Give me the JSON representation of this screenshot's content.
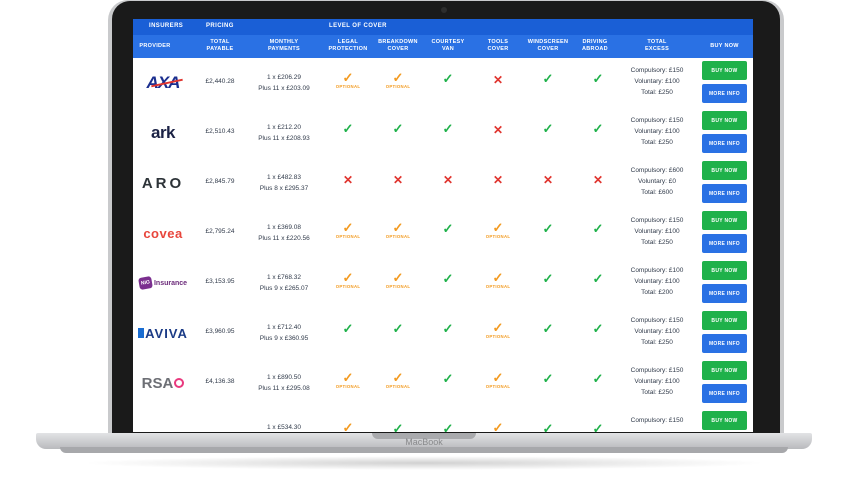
{
  "device_label": "MacBook",
  "header": {
    "groups": [
      "INSURERS",
      "PRICING",
      "LEVEL OF COVER"
    ],
    "columns": [
      "PROVIDER",
      "TOTAL\nPAYABLE",
      "MONTHLY\nPAYMENTS",
      "LEGAL\nPROTECTION",
      "BREAKDOWN\nCOVER",
      "COURTESY\nVAN",
      "TOOLS\nCOVER",
      "WINDSCREEN\nCOVER",
      "DRIVING\nABROAD",
      "TOTAL\nEXCESS",
      "BUY NOW"
    ]
  },
  "labels": {
    "optional": "OPTIONAL",
    "buy_now": "BUY NOW",
    "more_info": "MORE INFO"
  },
  "rows": [
    {
      "provider": "AXA",
      "logo_text": "AXA",
      "total": "£2,440.28",
      "m1": "1 x £206.29",
      "m2": "Plus 11 x £203.09",
      "cover": [
        "optional",
        "optional",
        "tick",
        "cross",
        "tick",
        "tick"
      ],
      "ex1": "Compulsory: £150",
      "ex2": "Voluntary: £100",
      "ex3": "Total: £250"
    },
    {
      "provider": "ark",
      "logo_text": "ark",
      "total": "£2,510.43",
      "m1": "1 x £212.20",
      "m2": "Plus 11 x £208.93",
      "cover": [
        "tick",
        "tick",
        "tick",
        "cross",
        "tick",
        "tick"
      ],
      "ex1": "Compulsory: £150",
      "ex2": "Voluntary: £100",
      "ex3": "Total: £250"
    },
    {
      "provider": "ARO",
      "logo_text": "ARO",
      "total": "£2,845.79",
      "m1": "1 x £482.83",
      "m2": "Plus 8 x £295.37",
      "cover": [
        "cross",
        "cross",
        "cross",
        "cross",
        "cross",
        "cross"
      ],
      "ex1": "Compulsory: £600",
      "ex2": "Voluntary: £0",
      "ex3": "Total: £600"
    },
    {
      "provider": "covea",
      "logo_text": "covea",
      "total": "£2,795.24",
      "m1": "1 x £369.08",
      "m2": "Plus 11 x £220.56",
      "cover": [
        "optional",
        "optional",
        "tick",
        "optional",
        "tick",
        "tick"
      ],
      "ex1": "Compulsory: £150",
      "ex2": "Voluntary: £100",
      "ex3": "Total: £250"
    },
    {
      "provider": "NIG Insurance",
      "logo_text": "Insurance",
      "logo_badge": "NIG",
      "total": "£3,153.95",
      "m1": "1 x £768.32",
      "m2": "Plus 9 x £265.07",
      "cover": [
        "optional",
        "optional",
        "tick",
        "optional",
        "tick",
        "tick"
      ],
      "ex1": "Compulsory: £100",
      "ex2": "Voluntary: £100",
      "ex3": "Total: £200"
    },
    {
      "provider": "AVIVA",
      "logo_text": "AVIVA",
      "total": "£3,960.95",
      "m1": "1 x £712.40",
      "m2": "Plus 9 x £360.95",
      "cover": [
        "tick",
        "tick",
        "tick",
        "optional",
        "tick",
        "tick"
      ],
      "ex1": "Compulsory: £150",
      "ex2": "Voluntary: £100",
      "ex3": "Total: £250"
    },
    {
      "provider": "RSA",
      "logo_text": "RSA",
      "total": "£4,136.38",
      "m1": "1 x £890.50",
      "m2": "Plus 11 x £295.08",
      "cover": [
        "optional",
        "optional",
        "tick",
        "optional",
        "tick",
        "tick"
      ],
      "ex1": "Compulsory: £150",
      "ex2": "Voluntary: £100",
      "ex3": "Total: £250"
    },
    {
      "provider": "",
      "logo_text": "",
      "total": "",
      "m1": "1 x £534.30",
      "m2": "",
      "cover": [
        "optional",
        "tick",
        "tick",
        "optional",
        "tick",
        "tick"
      ],
      "ex1": "Compulsory: £150",
      "ex2": "",
      "ex3": ""
    }
  ]
}
